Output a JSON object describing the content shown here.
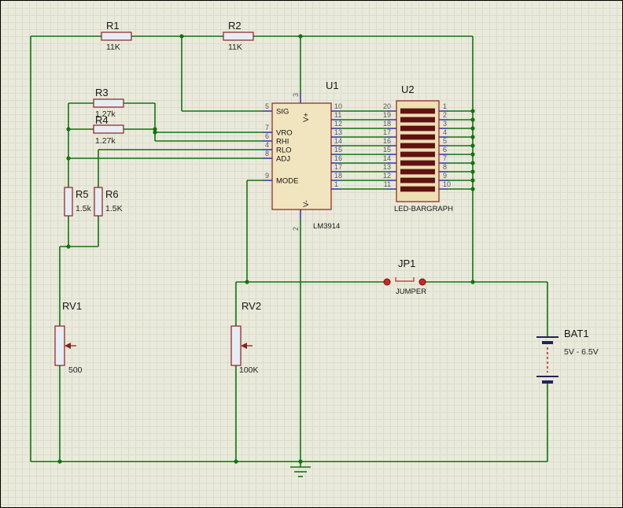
{
  "canvas": {
    "background": "#eaeadc",
    "wire_color": "#107410",
    "component_outline_color": "#8d1f1f",
    "led_bar_color": "#601212"
  },
  "components": {
    "r1": {
      "ref": "R1",
      "value": "11K"
    },
    "r2": {
      "ref": "R2",
      "value": "11K"
    },
    "r3": {
      "ref": "R3",
      "value": "1.27k"
    },
    "r4": {
      "ref": "R4",
      "value": "1.27k"
    },
    "r5": {
      "ref": "R5",
      "value": "1.5k"
    },
    "r6": {
      "ref": "R6",
      "value": "1.5K"
    },
    "rv1": {
      "ref": "RV1",
      "value": "500"
    },
    "rv2": {
      "ref": "RV2",
      "value": "100K"
    },
    "u1": {
      "ref": "U1",
      "part": "LM3914",
      "left_pins": [
        {
          "num": "5",
          "name": "SIG"
        },
        {
          "num": "7",
          "name": "VRO"
        },
        {
          "num": "6",
          "name": "RHI"
        },
        {
          "num": "4",
          "name": "RLO"
        },
        {
          "num": "8",
          "name": "ADJ"
        },
        {
          "num": "9",
          "name": "MODE"
        }
      ],
      "top_pin": {
        "num": "3",
        "name": "V+"
      },
      "bottom_pin": {
        "num": "2",
        "name": "V-"
      },
      "right_pins": [
        "10",
        "11",
        "12",
        "13",
        "14",
        "15",
        "16",
        "17",
        "18",
        "1"
      ]
    },
    "u2": {
      "ref": "U2",
      "part": "LED-BARGRAPH",
      "left_pins": [
        "20",
        "19",
        "18",
        "17",
        "16",
        "15",
        "14",
        "13",
        "12",
        "11"
      ],
      "right_pins": [
        "1",
        "2",
        "3",
        "4",
        "5",
        "6",
        "7",
        "8",
        "9",
        "10"
      ]
    },
    "jp1": {
      "ref": "JP1",
      "part": "JUMPER"
    },
    "bat1": {
      "ref": "BAT1",
      "value": "5V - 6.5V"
    }
  }
}
